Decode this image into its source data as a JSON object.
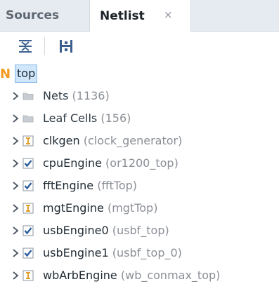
{
  "tabs": [
    {
      "label": "Sources",
      "active": false
    },
    {
      "label": "Netlist",
      "active": true,
      "close": "×"
    }
  ],
  "toolbar": {
    "buttons": [
      {
        "icon": "collapse-all-icon"
      },
      {
        "icon": "expand-all-icon"
      }
    ]
  },
  "root": {
    "badge": "N",
    "label": "top"
  },
  "groups": [
    {
      "name": "Nets",
      "count": "(1136)",
      "icon": "folder-icon"
    },
    {
      "name": "Leaf Cells",
      "count": "(156)",
      "icon": "folder-icon"
    }
  ],
  "cells": [
    {
      "name": "clkgen",
      "module": "(clock_generator)",
      "icon": "blackbox-cell-icon"
    },
    {
      "name": "cpuEngine",
      "module": "(or1200_top)",
      "icon": "checked-cell-icon"
    },
    {
      "name": "fftEngine",
      "module": "(fftTop)",
      "icon": "checked-cell-icon"
    },
    {
      "name": "mgtEngine",
      "module": "(mgtTop)",
      "icon": "blackbox-cell-icon"
    },
    {
      "name": "usbEngine0",
      "module": "(usbf_top)",
      "icon": "checked-cell-icon"
    },
    {
      "name": "usbEngine1",
      "module": "(usbf_top_0)",
      "icon": "checked-cell-icon"
    },
    {
      "name": "wbArbEngine",
      "module": "(wb_conmax_top)",
      "icon": "blackbox-cell-icon"
    }
  ],
  "colors": {
    "accent": "#f29b1f",
    "selection": "#cfe6fb",
    "checked_icon": "#2d5c9e",
    "blackbox_icon": "#e0a030"
  }
}
